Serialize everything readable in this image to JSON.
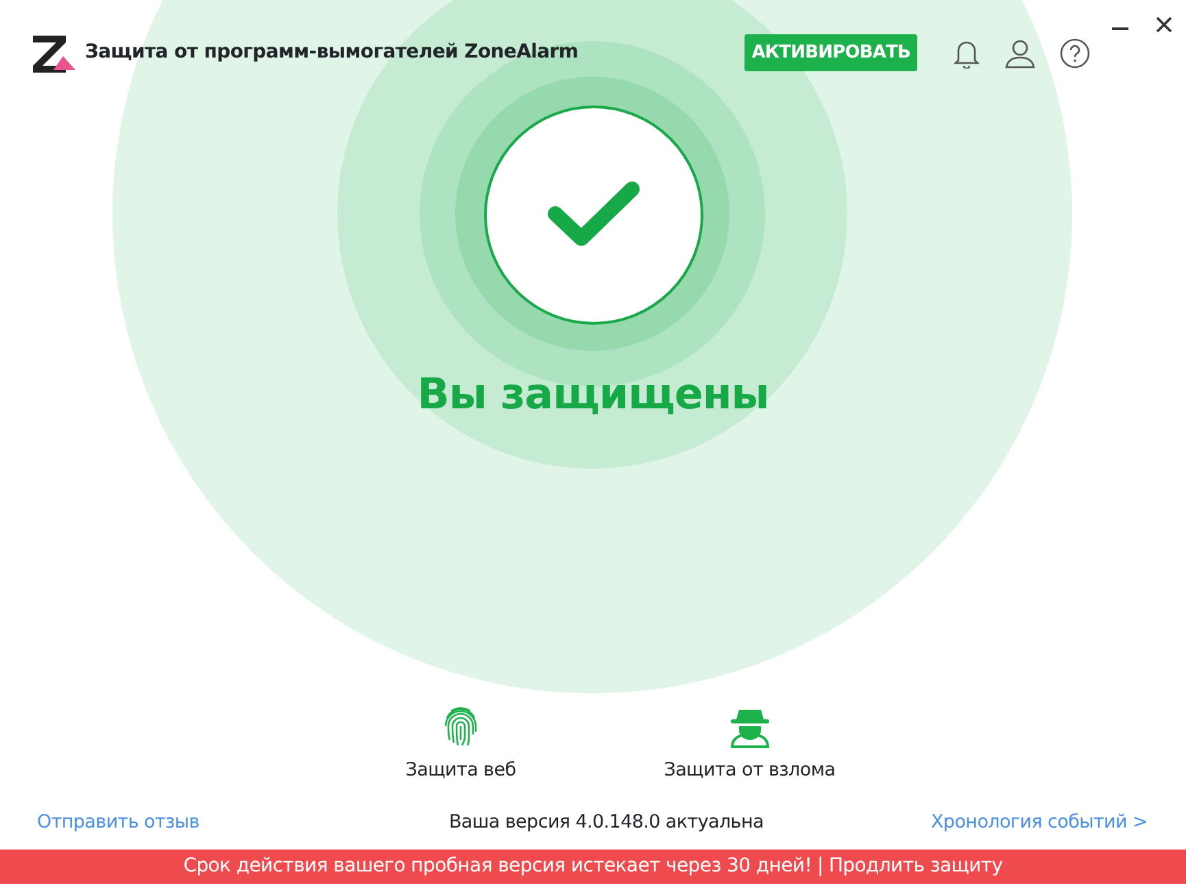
{
  "window": {
    "title": "Защита от программ-вымогателей ZoneAlarm"
  },
  "activate_button": "АКТИВИРОВАТЬ",
  "status": {
    "kind": "protected",
    "text": "Вы защищены"
  },
  "features": [
    {
      "kind": "fingerprint",
      "label": "Защита веб"
    },
    {
      "kind": "spy",
      "label": "Защита от взлома"
    }
  ],
  "footer": {
    "feedback_link": "Отправить отзыв",
    "version_text": "Ваша версия 4.0.148.0 актуальна",
    "history_link": "Хронология событий >"
  },
  "banner": {
    "message": "Срок действия вашего пробная версия истекает через 30 дней!",
    "separator": "|",
    "link": "Продлить защиту"
  }
}
